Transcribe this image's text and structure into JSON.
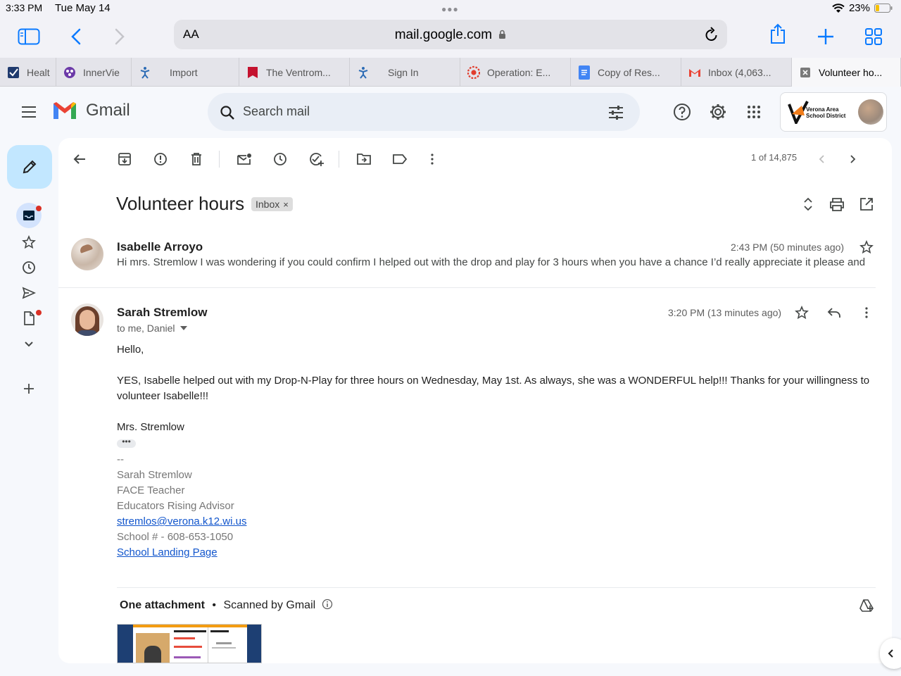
{
  "status_bar": {
    "time": "3:33 PM",
    "date": "Tue May 14",
    "battery": "23%"
  },
  "safari": {
    "aa_label": "AA",
    "url": "mail.google.com"
  },
  "tabs": [
    {
      "label": "Healt",
      "icon": "checkbox-icon"
    },
    {
      "label": "InnerVie",
      "icon": "innerview-icon"
    },
    {
      "label": "Import",
      "icon": "figure-icon"
    },
    {
      "label": "The Ventrom...",
      "icon": "bookmark-red-icon"
    },
    {
      "label": "Sign In",
      "icon": "figure-icon"
    },
    {
      "label": "Operation: E...",
      "icon": "canvas-icon"
    },
    {
      "label": "Copy of Res...",
      "icon": "docs-icon"
    },
    {
      "label": "Inbox (4,063...",
      "icon": "gmail-icon"
    },
    {
      "label": "Volunteer ho...",
      "icon": "close-icon"
    }
  ],
  "gmail": {
    "brand": "Gmail",
    "search_placeholder": "Search mail",
    "account_org": "Verona Area School District"
  },
  "toolbar": {
    "pager": "1 of 14,875"
  },
  "thread": {
    "subject": "Volunteer hours",
    "label": "Inbox",
    "messages": [
      {
        "sender": "Isabelle Arroyo",
        "time": "2:43 PM (50 minutes ago)",
        "snippet": "Hi mrs. Stremlow I was wondering if you could confirm I helped out with the drop and play for 3 hours when you have a chance I’d really appreciate it please and"
      },
      {
        "sender": "Sarah Stremlow",
        "time": "3:20 PM (13 minutes ago)",
        "recipients": "to me, Daniel",
        "greeting": "Hello,",
        "paragraph": "YES, Isabelle helped out with my Drop-N-Play for three hours on Wednesday, May 1st.  As always, she was a WONDERFUL help!!!  Thanks for your willingness to volunteer Isabelle!!!",
        "closing": "Mrs. Stremlow",
        "ellipsis": "•••",
        "signature": {
          "dashes": "--",
          "name": "Sarah Stremlow",
          "title1": "FACE Teacher",
          "title2": "Educators Rising Advisor",
          "email": "stremlos@verona.k12.wi.us",
          "phone": "School # - 608-653-1050",
          "landing": "School Landing Page"
        }
      }
    ],
    "attachments": {
      "count_label": "One attachment",
      "scanned_label": "Scanned by Gmail"
    }
  },
  "colors": {
    "accent": "#0a7aff",
    "compose_bg": "#c2e7ff",
    "panel_bg": "#f6f8fc",
    "link": "#1155cc",
    "badge": "#d93025"
  }
}
